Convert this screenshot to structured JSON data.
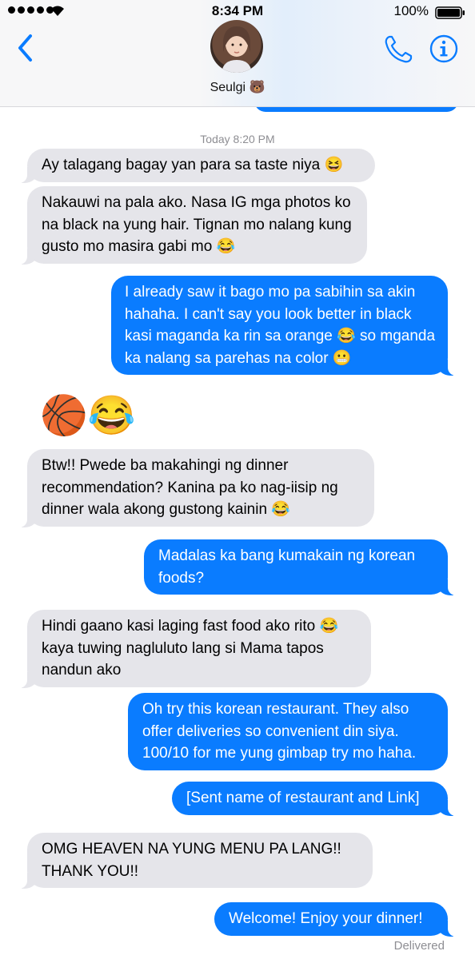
{
  "status_bar": {
    "time": "8:34 PM",
    "battery": "100%"
  },
  "header": {
    "contact_name": "Seulgi 🐻"
  },
  "thread": {
    "timestamp": "Today 8:20 PM",
    "messages": [
      {
        "from": "them",
        "text": "Ay talagang bagay yan para sa taste niya 😆"
      },
      {
        "from": "them",
        "text": "Nakauwi na pala ako. Nasa IG mga photos ko na black na yung hair. Tignan mo nalang kung gusto mo masira gabi mo 😂"
      },
      {
        "from": "me",
        "text": "I already saw it bago mo pa sabihin sa akin hahaha. I can't say you look better in black kasi maganda ka rin sa orange 😂 so mganda ka nalang sa parehas na color 😬"
      },
      {
        "from": "them",
        "text": "🏀😂"
      },
      {
        "from": "them",
        "text": "Btw!! Pwede ba makahingi ng dinner recommendation? Kanina pa ko nag-iisip ng dinner wala akong gustong kainin 😂"
      },
      {
        "from": "me",
        "text": "Madalas ka bang kumakain ng korean foods?"
      },
      {
        "from": "them",
        "text": "Hindi gaano kasi laging fast food ako rito 😂 kaya tuwing nagluluto lang si Mama tapos nandun ako"
      },
      {
        "from": "me",
        "text": "Oh try this korean restaurant. They also offer deliveries so convenient din siya. 100/10 for me yung gimbap try mo haha."
      },
      {
        "from": "me",
        "text": "[Sent name of restaurant and Link]"
      },
      {
        "from": "them",
        "text": "OMG HEAVEN NA YUNG MENU PA LANG!! THANK YOU!!"
      },
      {
        "from": "me",
        "text": "Welcome! Enjoy your dinner!"
      }
    ],
    "delivered": "Delivered"
  },
  "icons": {
    "back": "chevron-left-icon",
    "phone": "phone-icon",
    "info": "info-icon",
    "signal": "signal-dots-icon",
    "wifi": "wifi-icon",
    "battery": "battery-icon"
  },
  "colors": {
    "sent_bubble": "#0a7cff",
    "received_bubble": "#e5e5ea",
    "accent": "#0a7cff",
    "meta_text": "#8e8e93"
  }
}
